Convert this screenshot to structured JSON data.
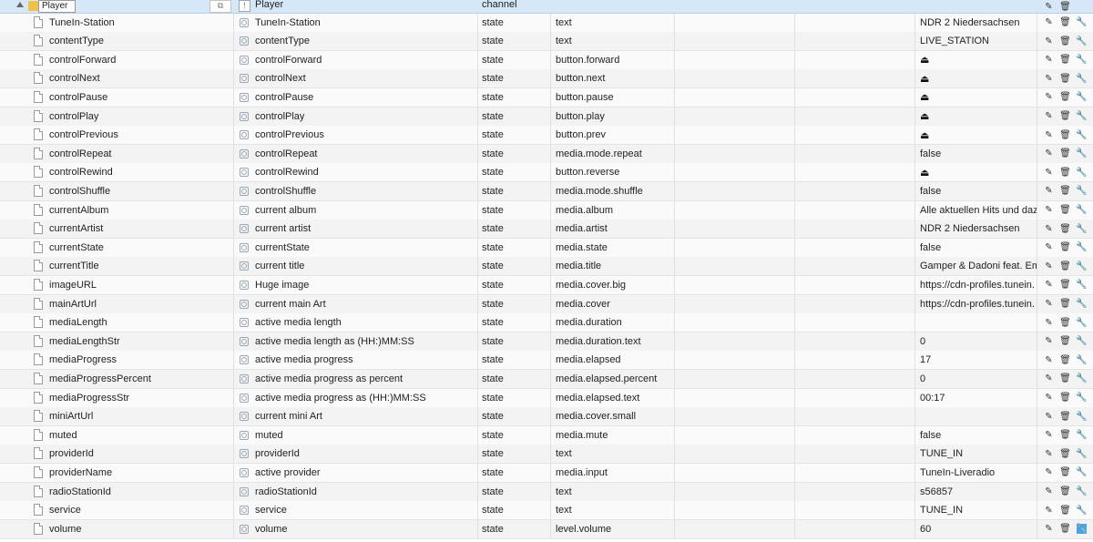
{
  "header": {
    "object_name": "Player",
    "description": "Player",
    "type": "channel",
    "tri_icon": "expand-triangle-icon",
    "folder_icon": "folder-icon"
  },
  "rows": [
    {
      "name": "TuneIn-Station",
      "desc": "TuneIn-Station",
      "type": "state",
      "role": "text",
      "value": "NDR 2 Niedersachsen"
    },
    {
      "name": "contentType",
      "desc": "contentType",
      "type": "state",
      "role": "text",
      "value": "LIVE_STATION"
    },
    {
      "name": "controlForward",
      "desc": "controlForward",
      "type": "state",
      "role": "button.forward",
      "value": "⏏"
    },
    {
      "name": "controlNext",
      "desc": "controlNext",
      "type": "state",
      "role": "button.next",
      "value": "⏏"
    },
    {
      "name": "controlPause",
      "desc": "controlPause",
      "type": "state",
      "role": "button.pause",
      "value": "⏏"
    },
    {
      "name": "controlPlay",
      "desc": "controlPlay",
      "type": "state",
      "role": "button.play",
      "value": "⏏"
    },
    {
      "name": "controlPrevious",
      "desc": "controlPrevious",
      "type": "state",
      "role": "button.prev",
      "value": "⏏"
    },
    {
      "name": "controlRepeat",
      "desc": "controlRepeat",
      "type": "state",
      "role": "media.mode.repeat",
      "value": "false"
    },
    {
      "name": "controlRewind",
      "desc": "controlRewind",
      "type": "state",
      "role": "button.reverse",
      "value": "⏏"
    },
    {
      "name": "controlShuffle",
      "desc": "controlShuffle",
      "type": "state",
      "role": "media.mode.shuffle",
      "value": "false"
    },
    {
      "name": "currentAlbum",
      "desc": "current album",
      "type": "state",
      "role": "media.album",
      "value": "Alle aktuellen Hits und daz"
    },
    {
      "name": "currentArtist",
      "desc": "current artist",
      "type": "state",
      "role": "media.artist",
      "value": "NDR 2 Niedersachsen"
    },
    {
      "name": "currentState",
      "desc": "currentState",
      "type": "state",
      "role": "media.state",
      "value": "false"
    },
    {
      "name": "currentTitle",
      "desc": "current title",
      "type": "state",
      "role": "media.title",
      "value": "Gamper & Dadoni feat. Em"
    },
    {
      "name": "imageURL",
      "desc": "Huge image",
      "type": "state",
      "role": "media.cover.big",
      "value": "https://cdn-profiles.tunein."
    },
    {
      "name": "mainArtUrl",
      "desc": "current main Art",
      "type": "state",
      "role": "media.cover",
      "value": "https://cdn-profiles.tunein."
    },
    {
      "name": "mediaLength",
      "desc": "active media length",
      "type": "state",
      "role": "media.duration",
      "value": ""
    },
    {
      "name": "mediaLengthStr",
      "desc": "active media length as (HH:)MM:SS",
      "type": "state",
      "role": "media.duration.text",
      "value": "0"
    },
    {
      "name": "mediaProgress",
      "desc": "active media progress",
      "type": "state",
      "role": "media.elapsed",
      "value": "17"
    },
    {
      "name": "mediaProgressPercent",
      "desc": "active media progress as percent",
      "type": "state",
      "role": "media.elapsed.percent",
      "value": "0"
    },
    {
      "name": "mediaProgressStr",
      "desc": "active media progress as (HH:)MM:SS",
      "type": "state",
      "role": "media.elapsed.text",
      "value": "00:17"
    },
    {
      "name": "miniArtUrl",
      "desc": "current mini Art",
      "type": "state",
      "role": "media.cover.small",
      "value": ""
    },
    {
      "name": "muted",
      "desc": "muted",
      "type": "state",
      "role": "media.mute",
      "value": "false"
    },
    {
      "name": "providerId",
      "desc": "providerId",
      "type": "state",
      "role": "text",
      "value": "TUNE_IN"
    },
    {
      "name": "providerName",
      "desc": "active provider",
      "type": "state",
      "role": "media.input",
      "value": "TuneIn-Liveradio"
    },
    {
      "name": "radioStationId",
      "desc": "radioStationId",
      "type": "state",
      "role": "text",
      "value": "s56857"
    },
    {
      "name": "service",
      "desc": "service",
      "type": "state",
      "role": "text",
      "value": "TUNE_IN"
    },
    {
      "name": "volume",
      "desc": "volume",
      "type": "state",
      "role": "level.volume",
      "value": "60"
    }
  ],
  "icons": {
    "edit": "pencil-icon",
    "delete": "trash-icon",
    "settings": "wrench-icon",
    "state": "state-icon",
    "file": "file-icon"
  }
}
